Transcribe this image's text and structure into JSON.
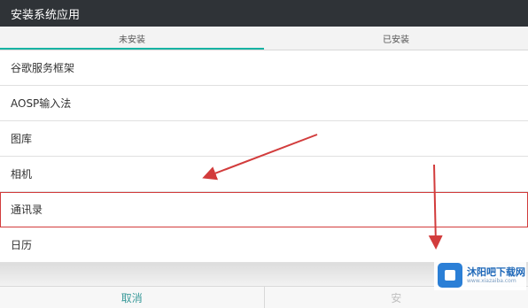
{
  "window": {
    "title": "安装系统应用"
  },
  "tabs": [
    {
      "label": "未安装",
      "active": true
    },
    {
      "label": "已安装",
      "active": false
    }
  ],
  "apps": [
    {
      "label": "谷歌服务框架"
    },
    {
      "label": "AOSP输入法"
    },
    {
      "label": "图库"
    },
    {
      "label": "相机"
    },
    {
      "label": "通讯录",
      "highlighted": true
    },
    {
      "label": "日历"
    }
  ],
  "footer": {
    "cancel_label": "取消",
    "confirm_label": "安"
  },
  "watermark": {
    "title": "沐阳吧下载网",
    "url": "www.xiazaiba.com"
  },
  "colors": {
    "accent": "#17b3a3",
    "annotation": "#d23c3c",
    "titlebar": "#2f3337"
  }
}
